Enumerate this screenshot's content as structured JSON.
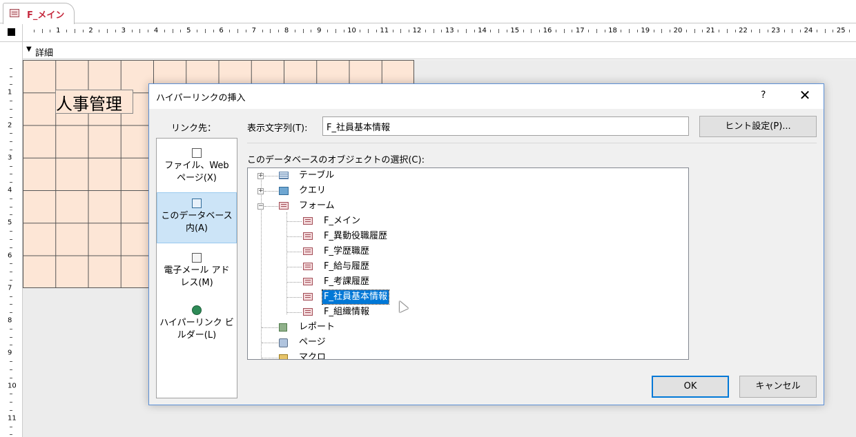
{
  "tab": {
    "label": "F_メイン",
    "icon": "form-icon"
  },
  "section": {
    "label": "詳細"
  },
  "ruler": {
    "h_numbers": [
      "1",
      "2",
      "3",
      "4",
      "5",
      "6",
      "7",
      "8",
      "9",
      "10",
      "11",
      "12",
      "13",
      "14",
      "15",
      "16",
      "17",
      "18",
      "19",
      "20",
      "21",
      "22",
      "23",
      "24",
      "25"
    ],
    "v_numbers": [
      "1",
      "2",
      "3",
      "4",
      "5",
      "6",
      "7",
      "8",
      "9",
      "10",
      "11"
    ]
  },
  "design": {
    "title_label": "人事管理",
    "grid_color": "#fde6d6"
  },
  "dialog": {
    "title": "ハイパーリンクの挿入",
    "help": "?",
    "close": "✕",
    "link_to_label": "リンク先：",
    "link_to_items": [
      {
        "label": "ファイル、Web ページ(X)",
        "icon": "file-web-icon"
      },
      {
        "label": "このデータベース内(A)",
        "icon": "database-icon"
      },
      {
        "label": "電子メール アドレス(M)",
        "icon": "email-icon"
      },
      {
        "label": "ハイパーリンク ビルダー(L)",
        "icon": "builder-icon"
      }
    ],
    "display_text_label": "表示文字列(T):",
    "display_text_value": "F_社員基本情報",
    "hint_button": "ヒント設定(P)...",
    "object_select_label": "このデータベースのオブジェクトの選択(C):",
    "tree": {
      "categories": [
        {
          "label": "テーブル",
          "expander": "+"
        },
        {
          "label": "クエリ",
          "expander": "+"
        },
        {
          "label": "フォーム",
          "expander": "−"
        }
      ],
      "forms": [
        "F_メイン",
        "F_異動役職履歴",
        "F_学歴職歴",
        "F_給与履歴",
        "F_考課履歴",
        "F_社員基本情報",
        "F_組織情報"
      ],
      "selected": "F_社員基本情報",
      "other_categories": [
        "レポート",
        "ページ",
        "マクロ"
      ]
    },
    "ok_button": "OK",
    "cancel_button": "キャンセル",
    "accent_color": "#0078d7"
  }
}
